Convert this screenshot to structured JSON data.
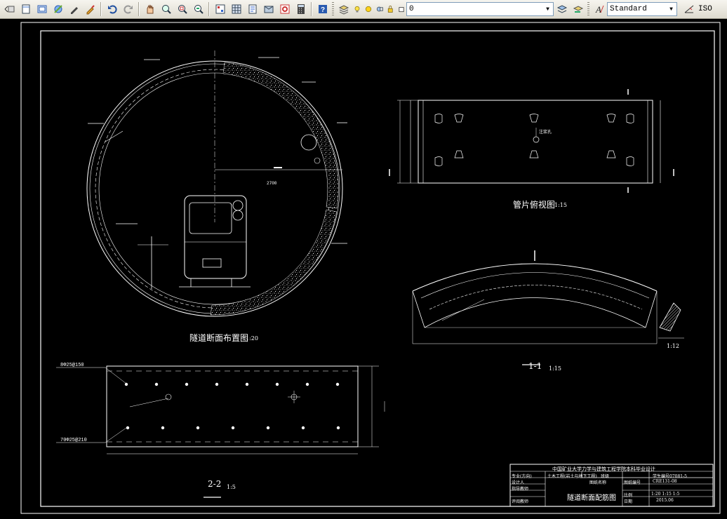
{
  "toolbar": {
    "layer_value": "0",
    "text_style_value": "Standard",
    "iso_label": "ISO",
    "icons": [
      "properties-icon",
      "new-file-icon",
      "open-icon",
      "save-icon",
      "match-properties-icon",
      "brush-icon",
      "undo-icon",
      "redo-icon",
      "pan-icon",
      "zoom-realtime-icon",
      "zoom-window-icon",
      "zoom-previous-icon",
      "properties-palette-icon",
      "design-center-icon",
      "tool-palettes-icon",
      "sheet-set-icon",
      "markup-icon",
      "calculator-icon",
      "help-icon",
      "layer-manager-icon",
      "layer-state-icon",
      "layer-previous-icon",
      "layer-isolate-icon",
      "text-style-icon",
      "dimension-style-icon"
    ]
  },
  "drawing": {
    "section_title": "隧道断面布置图",
    "section_scale": "1:20",
    "plan_title": "管片俯视图",
    "plan_scale": "1:15",
    "section11_title": "1-1",
    "section11_scale": "1:15",
    "section22_title": "2-2",
    "section22_scale": "1:5",
    "detail_scale": "1:12",
    "dim_2700": "2700",
    "plan_note": "注浆孔",
    "rebar_top": "8Φ25@150",
    "rebar_bottom": "70Φ25@210"
  },
  "title_block": {
    "header": "中国矿业大学力学与建筑工程学院本科毕业设计",
    "row1_col1": "专业(方向)",
    "row1_col2": "土木工程(岩土与地下工程)",
    "row1_col3": "班级",
    "row1_col4": "学生编号07081-5",
    "row2_col1": "设计人",
    "row2_col2": "图纸名称",
    "row2_col3": "图纸编号",
    "row2_col4": "CRE131-08",
    "row3_col1": "指导教师",
    "drawing_name": "隧道断面配筋图",
    "row3_col3": "比例",
    "row3_col4": "1:20 1:15 1:5",
    "row4_col1": "评阅教师",
    "row4_col3": "日期",
    "row4_col4": "2015.06"
  }
}
